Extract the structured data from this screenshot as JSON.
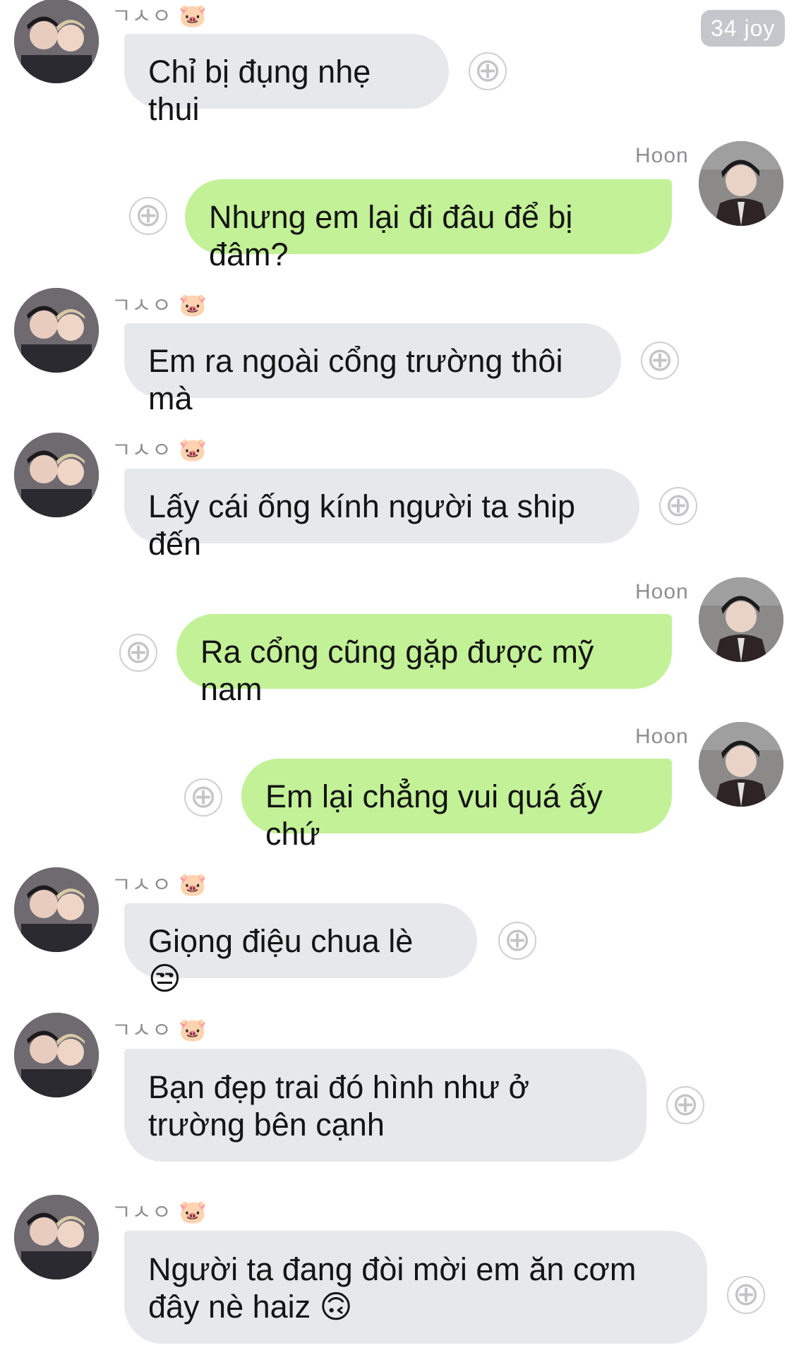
{
  "time_badge": "34 joy",
  "contact_name": "ㄱㅅㅇ",
  "contact_emoji": "🐷",
  "me_name": "Hoon",
  "plus_icon": "⊕",
  "messages": [
    {
      "side": "in",
      "text": "Chỉ bị đụng nhẹ thui"
    },
    {
      "side": "out",
      "text": "Nhưng em lại đi đâu để bị đâm?"
    },
    {
      "side": "in",
      "text": "Em ra ngoài cổng trường thôi mà"
    },
    {
      "side": "in",
      "text": "Lấy cái ống kính người ta ship đến"
    },
    {
      "side": "out",
      "text": "Ra cổng cũng gặp được mỹ nam"
    },
    {
      "side": "out",
      "text": "Em lại chẳng vui quá ấy chứ"
    },
    {
      "side": "in",
      "text": "Giọng điệu chua lè 😒"
    },
    {
      "side": "in",
      "text": "Bạn đẹp trai đó hình như ở trường bên cạnh"
    },
    {
      "side": "in",
      "text": "Người ta đang đòi mời em ăn cơm đây nè haiz 🙃"
    }
  ]
}
